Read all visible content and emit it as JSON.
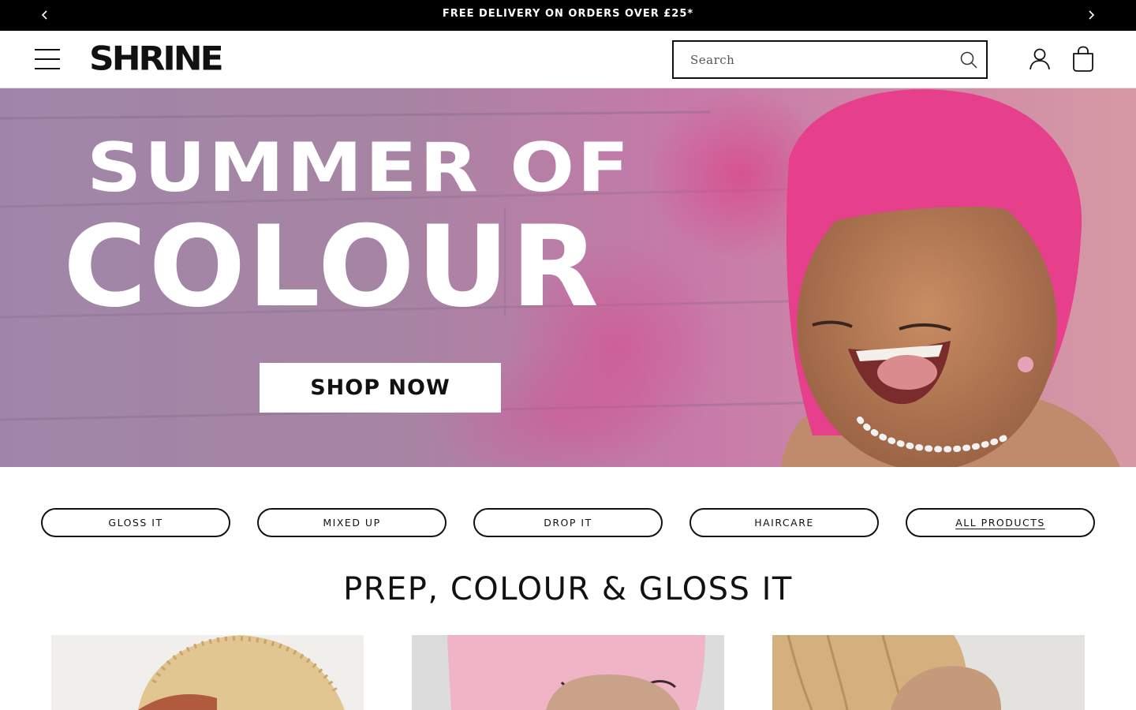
{
  "announcement": {
    "message": "FREE DELIVERY ON ORDERS OVER £25*",
    "prev_icon": "chevron-left-icon",
    "next_icon": "chevron-right-icon"
  },
  "header": {
    "logo_text": "SHRINE",
    "search": {
      "placeholder": "Search",
      "value": ""
    },
    "icons": [
      "menu-icon",
      "search-icon",
      "account-icon",
      "bag-icon"
    ]
  },
  "hero": {
    "line1": "SUMMER OF",
    "line2": "COLOUR",
    "cta_label": "SHOP NOW"
  },
  "collections": [
    {
      "label": "GLOSS IT",
      "active": false
    },
    {
      "label": "MIXED UP",
      "active": false
    },
    {
      "label": "DROP IT",
      "active": false
    },
    {
      "label": "HAIRCARE",
      "active": false
    },
    {
      "label": "ALL PRODUCTS",
      "active": true
    }
  ],
  "section": {
    "title": "PREP, COLOUR & GLOSS IT"
  },
  "colors": {
    "announcement_bg": "#000000",
    "accent_pink": "#e0458c",
    "hero_wall": "#b18aa6"
  }
}
